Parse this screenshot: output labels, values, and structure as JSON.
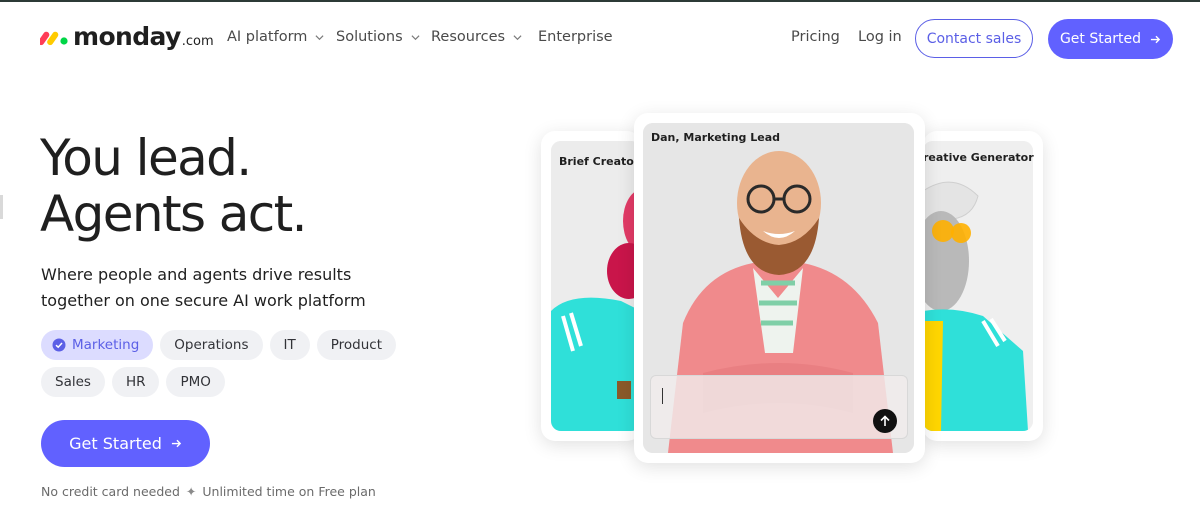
{
  "brand": {
    "name": "monday",
    "suffix": ".com",
    "colors": {
      "red": "#ff3d57",
      "yellow": "#ffcb00",
      "green": "#00d647",
      "primary": "#6161ff"
    }
  },
  "nav": {
    "items": [
      {
        "label": "AI platform",
        "dropdown": true
      },
      {
        "label": "Solutions",
        "dropdown": true
      },
      {
        "label": "Resources",
        "dropdown": true
      },
      {
        "label": "Enterprise",
        "dropdown": false
      }
    ],
    "pricing": "Pricing",
    "login": "Log in",
    "contact_sales": "Contact sales",
    "get_started": "Get Started"
  },
  "hero": {
    "headline_line1": "You lead.",
    "headline_line2": "Agents act.",
    "subhead": "Where people and agents drive results together on one secure AI work platform",
    "chips_row1": [
      {
        "label": "Marketing",
        "selected": true
      },
      {
        "label": "Operations",
        "selected": false
      },
      {
        "label": "IT",
        "selected": false
      },
      {
        "label": "Product",
        "selected": false
      }
    ],
    "chips_row2": [
      {
        "label": "Sales",
        "selected": false
      },
      {
        "label": "HR",
        "selected": false
      },
      {
        "label": "PMO",
        "selected": false
      }
    ],
    "cta": "Get Started",
    "footnote_left": "No credit card needed",
    "footnote_sep": "✦",
    "footnote_right": "Unlimited time on Free plan"
  },
  "cards": {
    "left_label": "Brief Creator",
    "center_label": "Dan, Marketing Lead",
    "right_label": "reative Generator",
    "prompt_value": ""
  },
  "icons": {
    "chevron": "chevron-down-icon",
    "arrow": "arrow-right-icon",
    "check": "check-circle-icon",
    "send": "arrow-up-icon"
  }
}
